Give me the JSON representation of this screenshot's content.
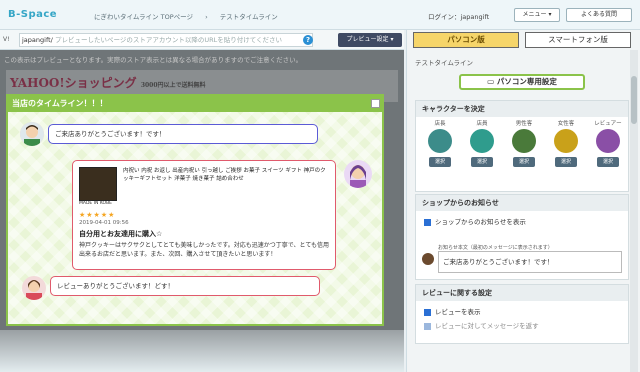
{
  "app": {
    "logo": "B-Space",
    "breadcrumb": [
      "にぎわいタイムライン TOPページ",
      "テストタイムライン"
    ],
    "login": "ログイン：japangift",
    "menu_btn": "メニュー ▾",
    "faq_btn": "よくある質問"
  },
  "urlbar": {
    "prefix": "V!",
    "store": "japangift/",
    "placeholder": "プレビューしたいページのストアアカウント以降のURLを貼り付けてください",
    "preview_btn": "プレビュー設定 ▾"
  },
  "preview": {
    "notice": "この表示はプレビューとなります。実際のストア表示とは異なる場合がありますのでご注意ください。",
    "yahoo": "YAHOO!ショッピング",
    "yahoo_sub": "3000円以上で送料無料"
  },
  "modal": {
    "title": "当店のタイムライン！！！",
    "greeting": "ご来店ありがとうございます！です！",
    "product_title": "内祝い 内祝 お返し 出産内祝い 引っ越し ご挨拶 お菓子 スイーツ ギフト 神戸のクッキーギフトセット 洋菓子 焼き菓子 詰め合わせ",
    "product_caption": "MADE IN KOBE",
    "rating": "★★★★★",
    "review_date": "2019-04-01 09:56",
    "review_title": "自分用とお友達用に購入☆",
    "review_body": "神戸クッキーはサクサクとしてとても美味しかったです。対応も迅速かつ丁寧で、とても信用出来るお店だと思います。また、次回、購入させて頂きたいと思います！",
    "reply": "レビューありがとうございます！どす！"
  },
  "side": {
    "tab_pc": "パソコン版",
    "tab_sp": "スマートフォン版",
    "subtitle": "テストタイムライン",
    "pc_head": "パソコン専用設定",
    "character": {
      "header": "キャラクターを決定",
      "items": [
        {
          "cap": "店長",
          "sel": "選択"
        },
        {
          "cap": "店員",
          "sel": "選択"
        },
        {
          "cap": "男性客",
          "sel": "選択"
        },
        {
          "cap": "女性客",
          "sel": "選択"
        },
        {
          "cap": "レビュアー",
          "sel": "選択"
        }
      ]
    },
    "shop_news": {
      "header": "ショップからのお知らせ",
      "checkbox": "ショップからのお知らせを表示",
      "ta_label": "お知らせ本文（最初のメッセージに表示されます）",
      "ta_value": "ご来店ありがとうございます！です！"
    },
    "review": {
      "header": "レビューに関する設定",
      "cb1": "レビューを表示",
      "cb2": "レビューに対してメッセージを返す"
    }
  },
  "colors": {
    "accent": "#8bc34a",
    "blue": "#2a6fd4",
    "pink": "#e05a6c",
    "purple": "#5b5bd6"
  }
}
